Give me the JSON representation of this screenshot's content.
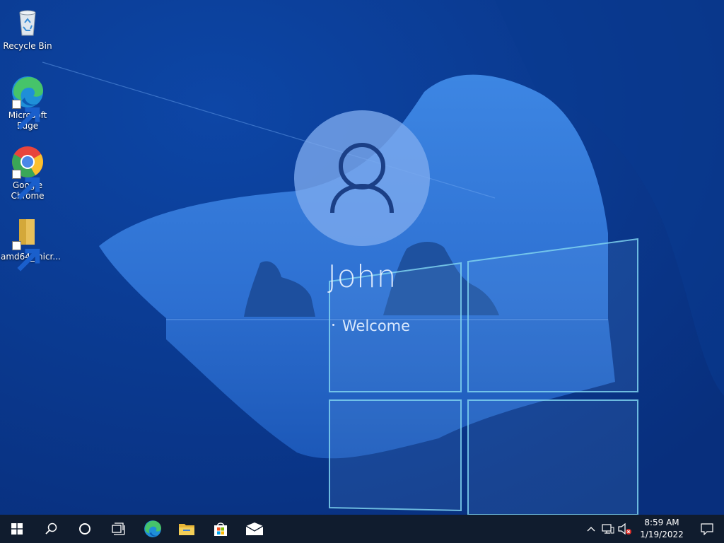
{
  "desktop": {
    "icons": [
      {
        "label": "Recycle Bin",
        "icon": "recycle-bin-icon"
      },
      {
        "label": "Microsoft Edge",
        "icon": "edge-icon"
      },
      {
        "label": "Google Chrome",
        "icon": "chrome-icon"
      },
      {
        "label": "amd64_micr...",
        "icon": "folder-icon"
      }
    ]
  },
  "lockscreen": {
    "user_name": "John",
    "status": "Welcome",
    "avatar_icon": "user-avatar-icon"
  },
  "taskbar": {
    "buttons": [
      {
        "name": "start-button",
        "icon": "windows-logo-icon"
      },
      {
        "name": "search-button",
        "icon": "search-icon"
      },
      {
        "name": "cortana-button",
        "icon": "cortana-circle-icon"
      },
      {
        "name": "task-view-button",
        "icon": "task-view-icon"
      },
      {
        "name": "edge-taskbar-button",
        "icon": "edge-icon"
      },
      {
        "name": "file-explorer-button",
        "icon": "file-explorer-icon"
      },
      {
        "name": "store-button",
        "icon": "microsoft-store-icon"
      },
      {
        "name": "mail-button",
        "icon": "mail-icon"
      }
    ],
    "tray": {
      "icons": [
        "chevron-up-icon",
        "network-icon",
        "volume-muted-icon"
      ],
      "time": "8:59 AM",
      "date": "1/19/2022",
      "notification_icon": "action-center-icon"
    }
  },
  "colors": {
    "background": "#0b3f98",
    "taskbar": "#101c2e",
    "avatar": "#7daaee",
    "accent": "#0078d7"
  }
}
